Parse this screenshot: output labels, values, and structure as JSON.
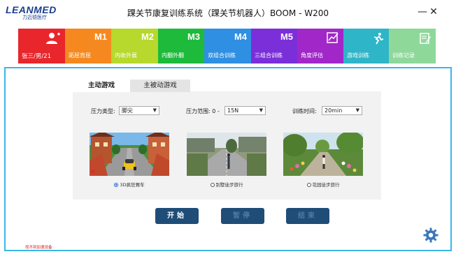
{
  "app": {
    "logo_text": "LEANMED",
    "logo_sub": "力迈德医疗",
    "title": "踝关节康复训练系统（踝关节机器人）BOOM - W200",
    "minimize": "—",
    "close": "✕"
  },
  "tabs": [
    {
      "id": "profile",
      "badge": "",
      "label": "张三/男/21",
      "color": "#e8262b",
      "icon": "user-add-icon"
    },
    {
      "id": "m1",
      "badge": "M1",
      "label": "跖屈背屈",
      "color": "#f5891f",
      "icon": ""
    },
    {
      "id": "m2",
      "badge": "M2",
      "label": "内收外展",
      "color": "#b7d82c",
      "icon": ""
    },
    {
      "id": "m3",
      "badge": "M3",
      "label": "内翻外翻",
      "color": "#1eba3b",
      "icon": ""
    },
    {
      "id": "m4",
      "badge": "M4",
      "label": "双组合训练",
      "color": "#2f8fe3",
      "icon": ""
    },
    {
      "id": "m5",
      "badge": "M5",
      "label": "三组合训练",
      "color": "#7b2fd9",
      "icon": ""
    },
    {
      "id": "angle",
      "badge": "",
      "label": "角度评估",
      "color": "#a127c9",
      "icon": "chart-edit-icon"
    },
    {
      "id": "game",
      "badge": "",
      "label": "游戏训练",
      "color": "#2fb5c8",
      "icon": "running-icon"
    },
    {
      "id": "records",
      "badge": "",
      "label": "训练记录",
      "color": "#8ed89a",
      "icon": "notepad-icon"
    }
  ],
  "subtabs": {
    "active": "主动游戏",
    "inactive": "主被动游戏"
  },
  "controls": {
    "pressure_type_label": "压力类型:",
    "pressure_type_value": "脚尖",
    "pressure_range_label": "压力范围: 0 -",
    "pressure_range_value": "15N",
    "train_time_label": "训练时间:",
    "train_time_value": "20min"
  },
  "games": [
    {
      "caption": "3D疯狂赛车",
      "selected": true,
      "scene": "racing"
    },
    {
      "caption": "别墅徒步旅行",
      "selected": false,
      "scene": "villa"
    },
    {
      "caption": "花园徒步旅行",
      "selected": false,
      "scene": "garden"
    }
  ],
  "buttons": {
    "start": "开始",
    "pause": "暂停",
    "end": "结束"
  },
  "footnote": "找不到加速设备"
}
